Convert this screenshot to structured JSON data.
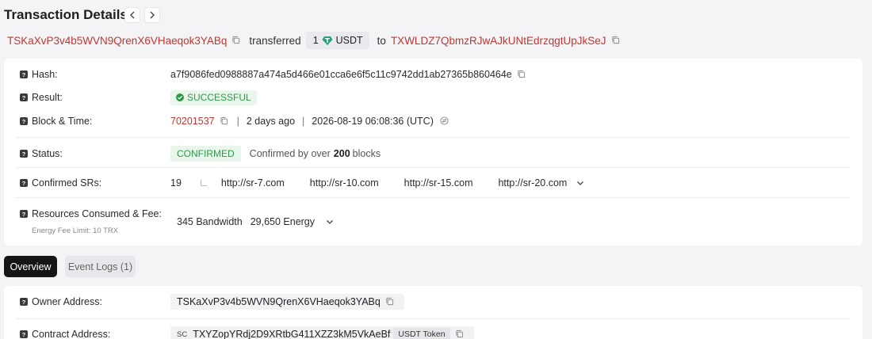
{
  "header": {
    "title": "Transaction Details",
    "prev_icon": "chevron-left-icon",
    "next_icon": "chevron-right-icon"
  },
  "summary": {
    "from_address": "TSKaXvP3v4b5WVN9QrenX6VHaeqok3YABq",
    "verb": "transferred",
    "amount": "1",
    "token_symbol": "USDT",
    "token_icon": "tether-icon",
    "preposition": "to",
    "to_address": "TXWLDZ7QbmzRJwAJkUNtEdrzqgtUpJkSeJ"
  },
  "details": {
    "hash": {
      "label": "Hash:",
      "value": "a7f9086fed0988887a474a5d466e01cca6e6f5c11c9742dd1ab27365b860464e"
    },
    "result": {
      "label": "Result:",
      "value": "SUCCESSFUL"
    },
    "block_time": {
      "label": "Block & Time:",
      "block": "70201537",
      "separator": "|",
      "relative": "2 days ago",
      "absolute": "2026-08-19 06:08:36 (UTC)"
    },
    "status": {
      "label": "Status:",
      "badge": "CONFIRMED",
      "text_prefix": "Confirmed by over",
      "count": "200",
      "text_suffix": "blocks"
    },
    "confirmed_srs": {
      "label": "Confirmed SRs:",
      "count": "19",
      "links": [
        "http://sr-7.com",
        "http://sr-10.com",
        "http://sr-15.com",
        "http://sr-20.com"
      ]
    },
    "resources": {
      "label": "Resources Consumed & Fee:",
      "sublabel": "Energy Fee Limit: 10 TRX",
      "bandwidth": "345 Bandwidth",
      "energy": "29,650 Energy"
    }
  },
  "tabs": [
    {
      "label": "Overview",
      "active": true
    },
    {
      "label": "Event Logs (1)",
      "active": false
    }
  ],
  "overview": {
    "owner": {
      "label": "Owner Address:",
      "value": "TSKaXvP3v4b5WVN9QrenX6VHaeqok3YABq"
    },
    "contract": {
      "label": "Contract Address:",
      "tag": "SC",
      "value": "TXYZopYRdj2D9XRtbG411XZZ3kM5VkAeBf",
      "token_tag": "USDT Token"
    }
  },
  "colors": {
    "address_link": "#c23631",
    "success_text": "#2d9a4a",
    "success_bg": "#e9f6ec",
    "active_tab_bg": "#151515",
    "page_bg": "#f4f4f6"
  }
}
